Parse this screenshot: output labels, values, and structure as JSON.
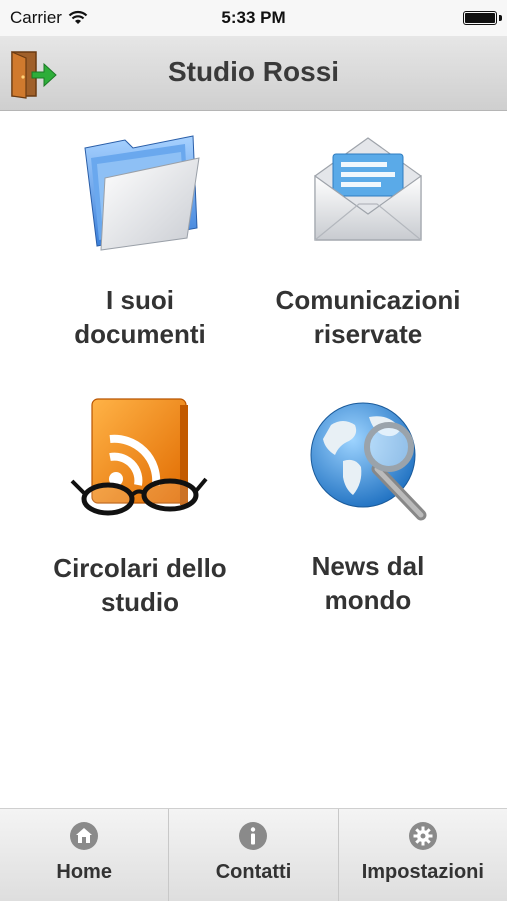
{
  "status_bar": {
    "carrier": "Carrier",
    "time": "5:33 PM"
  },
  "nav": {
    "title": "Studio Rossi",
    "back_icon": "logout-door-icon"
  },
  "tiles": [
    {
      "label": "I suoi\ndocumenti",
      "icon": "folder-icon"
    },
    {
      "label": "Comunicazioni\nriservate",
      "icon": "envelope-icon"
    },
    {
      "label": "Circolari dello\nstudio",
      "icon": "rss-glasses-icon"
    },
    {
      "label": "News dal\nmondo",
      "icon": "globe-search-icon"
    }
  ],
  "tab_bar": {
    "items": [
      {
        "label": "Home",
        "icon": "home-icon"
      },
      {
        "label": "Contatti",
        "icon": "info-icon"
      },
      {
        "label": "Impostazioni",
        "icon": "gear-icon"
      }
    ]
  },
  "colors": {
    "nav_bg": "#d9d9d9",
    "text": "#333333",
    "tab_icon": "#8a8a8a"
  }
}
